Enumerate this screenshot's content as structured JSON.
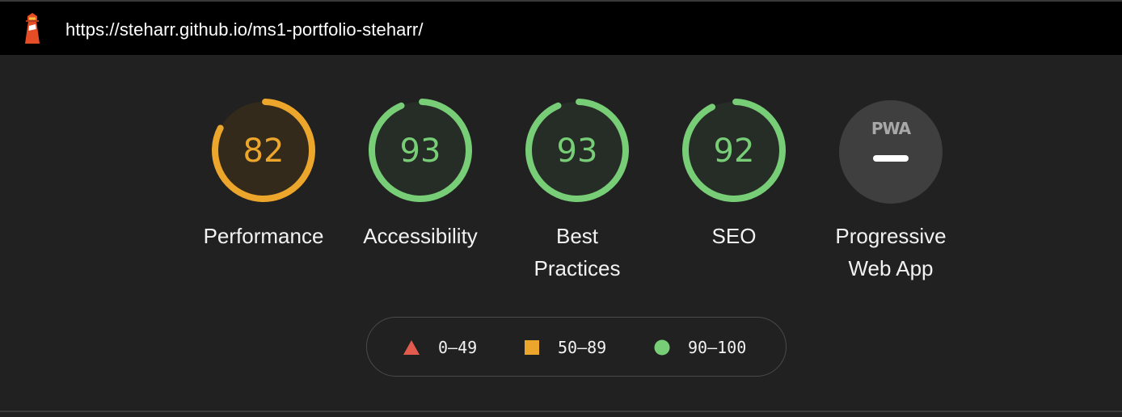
{
  "header": {
    "url": "https://steharr.github.io/ms1-portfolio-steharr/",
    "icon": "lighthouse-icon"
  },
  "gauges": [
    {
      "label_line1": "Performance",
      "label_line2": "",
      "score": "82",
      "percent": 82,
      "status": "average",
      "color": "#ECA62B",
      "fill": "#332A1B"
    },
    {
      "label_line1": "Accessibility",
      "label_line2": "",
      "score": "93",
      "percent": 93,
      "status": "pass",
      "color": "#77CE77",
      "fill": "#262D26"
    },
    {
      "label_line1": "Best",
      "label_line2": "Practices",
      "score": "93",
      "percent": 93,
      "status": "pass",
      "color": "#77CE77",
      "fill": "#262D26"
    },
    {
      "label_line1": "SEO",
      "label_line2": "",
      "score": "92",
      "percent": 92,
      "status": "pass",
      "color": "#77CE77",
      "fill": "#262D26"
    }
  ],
  "pwa": {
    "badge_text": "PWA",
    "label_line1": "Progressive",
    "label_line2": "Web App",
    "color": "#3F3F3F"
  },
  "legend": [
    {
      "shape": "triangle",
      "range": "0–49",
      "color": "#E35B4D"
    },
    {
      "shape": "square",
      "range": "50–89",
      "color": "#ECA62B"
    },
    {
      "shape": "circle",
      "range": "90–100",
      "color": "#77CE77"
    }
  ]
}
